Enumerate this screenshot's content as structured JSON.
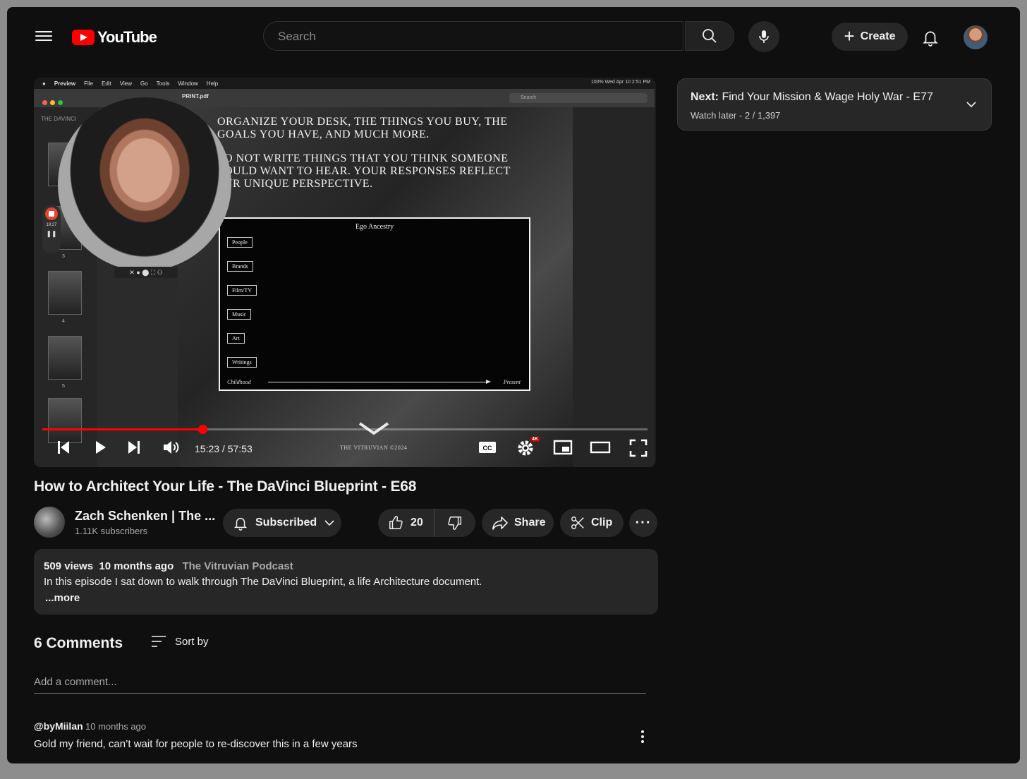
{
  "header": {
    "logo_text": "YouTube",
    "search_placeholder": "Search",
    "create_label": "Create"
  },
  "video": {
    "mac_menu": [
      "Preview",
      "File",
      "Edit",
      "View",
      "Go",
      "Tools",
      "Window",
      "Help"
    ],
    "mac_status": "100%   Wed Apr 10  2:51 PM",
    "pdf_title": "PRINT.pdf",
    "pdf_search": "Search",
    "sidebar_label": "THE DAVINCI",
    "thumb_pages": [
      "3",
      "4",
      "5"
    ],
    "rec_time": "19:27",
    "doc_lines": [
      "ORGANIZE YOUR DESK, THE THINGS YOU BUY, THE",
      "GOALS YOU HAVE, AND MUCH MORE.",
      "O NOT WRITE THINGS THAT YOU THINK SOMEONE",
      "OULD WANT TO HEAR. YOUR RESPONSES REFLECT",
      "UR UNIQUE PERSPECTIVE."
    ],
    "chart_title": "Ego Ancestry",
    "chart_items": [
      "People",
      "Brands",
      "Film/TV",
      "Music",
      "Art",
      "Writings"
    ],
    "axis_left": "Childhood",
    "axis_right": "Present",
    "watermark": "THE VITRUVIAN ©2024",
    "time_display": "15:23 / 57:53",
    "progress_fraction": 0.265,
    "quality_badge": "4K",
    "title": "How to Architect Your Life - The DaVinci Blueprint - E68"
  },
  "next": {
    "prefix": "Next:",
    "title": "Find Your Mission & Wage Holy War - E77",
    "sub": "Watch later - 2 / 1,397"
  },
  "channel": {
    "name": "Zach Schenken | The ...",
    "subscribers": "1.11K subscribers",
    "subscribe_label": "Subscribed"
  },
  "actions": {
    "likes": "20",
    "share": "Share",
    "clip": "Clip"
  },
  "description": {
    "views": "509 views",
    "age": "10 months ago",
    "podcast": "The Vitruvian Podcast",
    "text": "In this episode I sat down to walk through The DaVinci Blueprint, a life Architecture document.",
    "more": "...more"
  },
  "comments": {
    "count": "6 Comments",
    "sort_label": "Sort by",
    "add_placeholder": "Add a comment...",
    "items": [
      {
        "author": "@byMiilan",
        "time": "10 months ago",
        "text": "Gold my friend, can’t wait for people to re-discover this in a few years"
      }
    ]
  }
}
